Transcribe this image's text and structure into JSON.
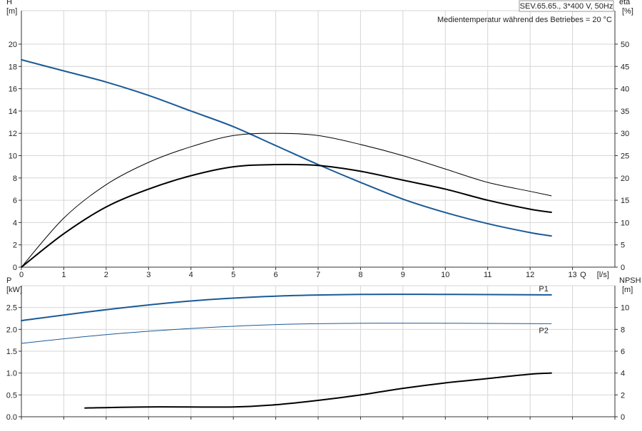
{
  "chart_data": [
    {
      "type": "line",
      "name_box": "SEV.65.65., 3*400 V, 50Hz",
      "annotation": "Medientemperatur während des Betriebes = 20 °C",
      "xlabel": "Q",
      "xunit": "[l/s]",
      "ylabel_left": "H",
      "yunit_left": "[m]",
      "ylabel_right": "eta",
      "yunit_right": "[%]",
      "xlim": [
        0,
        14
      ],
      "xtick_labels": [
        "0",
        "1",
        "2",
        "3",
        "4",
        "5",
        "6",
        "7",
        "8",
        "9",
        "10",
        "11",
        "12",
        "13"
      ],
      "ylim_left": [
        0,
        23
      ],
      "yticks_left": [
        "0",
        "2",
        "4",
        "6",
        "8",
        "10",
        "12",
        "14",
        "16",
        "18",
        "20"
      ],
      "ylim_right": [
        0,
        57.5
      ],
      "yticks_right": [
        "0",
        "5",
        "10",
        "15",
        "20",
        "25",
        "30",
        "35",
        "40",
        "45",
        "50"
      ],
      "grid": true,
      "series": [
        {
          "axis": "left",
          "color": "#1a5a96",
          "stroke_width": 2,
          "x": [
            0,
            1,
            2,
            3,
            4,
            5,
            6,
            7,
            8,
            9,
            10,
            11,
            12,
            12.5
          ],
          "y": [
            18.6,
            17.6,
            16.6,
            15.4,
            14.0,
            12.6,
            10.9,
            9.2,
            7.6,
            6.1,
            4.9,
            3.9,
            3.1,
            2.8
          ]
        },
        {
          "axis": "right",
          "color": "#000000",
          "stroke_width": 1,
          "x": [
            0,
            1,
            2,
            3,
            4,
            5,
            6,
            7,
            8,
            9,
            10,
            11,
            12,
            12.5
          ],
          "y": [
            0,
            11,
            18.5,
            23.5,
            27,
            29.5,
            30,
            29.5,
            27.5,
            25,
            22,
            19,
            17,
            16
          ]
        },
        {
          "axis": "right",
          "color": "#000000",
          "stroke_width": 2,
          "x": [
            0,
            1,
            2,
            3,
            4,
            5,
            6,
            7,
            8,
            9,
            10,
            11,
            12,
            12.5
          ],
          "y": [
            0,
            7.5,
            13.5,
            17.5,
            20.5,
            22.5,
            23,
            22.8,
            21.5,
            19.5,
            17.5,
            15,
            13,
            12.3
          ]
        }
      ]
    },
    {
      "type": "line",
      "ylabel_left": "P",
      "yunit_left": "[kW]",
      "ylabel_right": "NPSH",
      "yunit_right": "[m]",
      "xlim": [
        0,
        14
      ],
      "ylim_left": [
        0,
        3.0
      ],
      "yticks_left": [
        "0.0",
        "0.5",
        "1.0",
        "1.5",
        "2.0",
        "2.5"
      ],
      "ylim_right": [
        0,
        12
      ],
      "yticks_right": [
        "0",
        "2",
        "4",
        "6",
        "8",
        "10"
      ],
      "grid": true,
      "series": [
        {
          "name": "P1",
          "axis": "left",
          "color": "#1a5a96",
          "stroke_width": 2,
          "x": [
            0,
            2,
            4,
            6,
            8,
            10,
            12.5
          ],
          "y": [
            2.2,
            2.45,
            2.65,
            2.76,
            2.8,
            2.8,
            2.79
          ]
        },
        {
          "name": "P2",
          "axis": "left",
          "color": "#1a5a96",
          "stroke_width": 1,
          "x": [
            0,
            2,
            4,
            6,
            8,
            10,
            12.5
          ],
          "y": [
            1.68,
            1.88,
            2.02,
            2.11,
            2.14,
            2.14,
            2.13
          ]
        },
        {
          "axis": "right",
          "color": "#000000",
          "stroke_width": 2,
          "x": [
            1.5,
            3,
            5,
            6,
            7,
            8,
            9,
            10,
            11,
            12,
            12.5
          ],
          "y": [
            0.8,
            0.9,
            0.9,
            1.1,
            1.5,
            2.0,
            2.6,
            3.1,
            3.5,
            3.9,
            4.0
          ]
        }
      ]
    }
  ]
}
